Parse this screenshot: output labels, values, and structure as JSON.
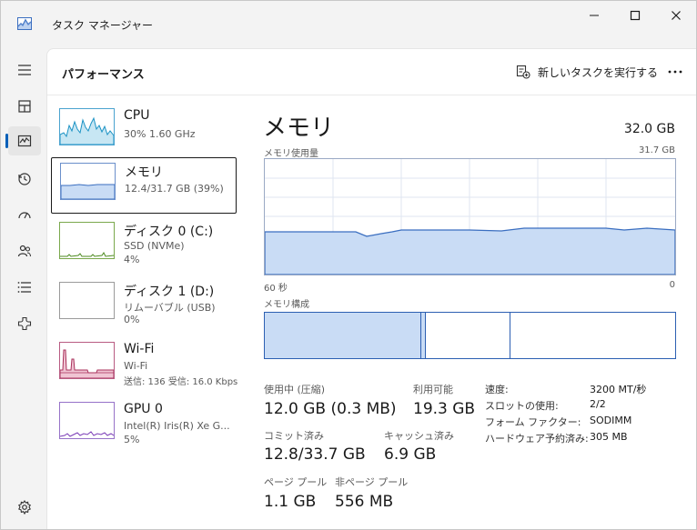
{
  "window": {
    "title": "タスク マネージャー"
  },
  "header": {
    "page_title": "パフォーマンス",
    "run_task_label": "新しいタスクを実行する"
  },
  "nav": {
    "items": [
      {
        "icon": "hamburger-icon"
      },
      {
        "icon": "processes-icon"
      },
      {
        "icon": "performance-icon",
        "active": true
      },
      {
        "icon": "app-history-icon"
      },
      {
        "icon": "startup-apps-icon"
      },
      {
        "icon": "users-icon"
      },
      {
        "icon": "details-icon"
      },
      {
        "icon": "services-icon"
      },
      {
        "icon": "settings-icon"
      }
    ]
  },
  "perf_list": {
    "cpu": {
      "name": "CPU",
      "sub1": "30%  1.60 GHz"
    },
    "memory": {
      "name": "メモリ",
      "sub1": "12.4/31.7 GB (39%)"
    },
    "disk0": {
      "name": "ディスク 0 (C:)",
      "sub1": "SSD (NVMe)",
      "sub2": "4%"
    },
    "disk1": {
      "name": "ディスク 1 (D:)",
      "sub1": "リムーバブル (USB)",
      "sub2": "0%"
    },
    "wifi": {
      "name": "Wi-Fi",
      "sub1": "Wi-Fi",
      "sub2": "送信: 136 受信: 16.0 Kbps"
    },
    "gpu0": {
      "name": "GPU 0",
      "sub1": "Intel(R) Iris(R) Xe G...",
      "sub2": "5%"
    }
  },
  "detail": {
    "title": "メモリ",
    "total": "32.0 GB",
    "usage_label": "メモリ使用量",
    "usage_max": "31.7 GB",
    "x_left": "60 秒",
    "x_right": "0",
    "composition_label": "メモリ構成",
    "stats": {
      "in_use_label": "使用中 (圧縮)",
      "in_use_value": "12.0 GB (0.3 MB)",
      "available_label": "利用可能",
      "available_value": "19.3 GB",
      "committed_label": "コミット済み",
      "committed_value": "12.8/33.7 GB",
      "cached_label": "キャッシュ済み",
      "cached_value": "6.9 GB",
      "paged_label": "ページ プール",
      "paged_value": "1.1 GB",
      "nonpaged_label": "非ページ プール",
      "nonpaged_value": "556 MB"
    },
    "specs": [
      {
        "label": "速度:",
        "value": "3200 MT/秒"
      },
      {
        "label": "スロットの使用:",
        "value": "2/2"
      },
      {
        "label": "フォーム ファクター:",
        "value": "SODIMM"
      },
      {
        "label": "ハードウェア予約済み:",
        "value": "305 MB"
      }
    ]
  },
  "colors": {
    "memory_line": "#3a6ec0",
    "memory_fill": "#c9dcf5",
    "cpu_line": "#1a92c4",
    "cpu_fill": "#c7e6f3",
    "disk_line": "#4c8a1f",
    "wifi_line": "#a8315b",
    "wifi_fill": "#f0c4d3",
    "gpu_line": "#7a3bb6",
    "accent": "#005fb8"
  }
}
